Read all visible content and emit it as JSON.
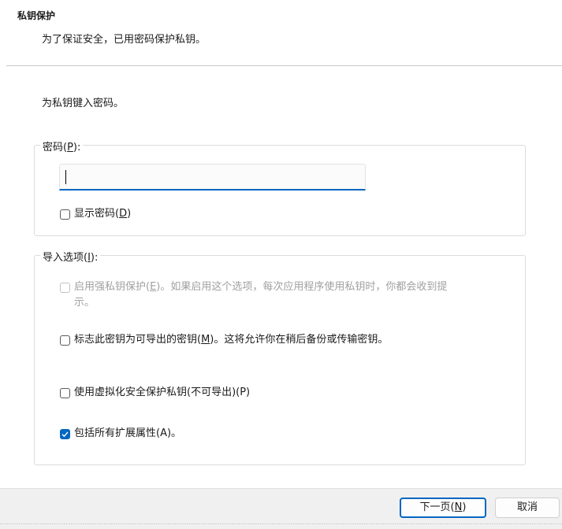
{
  "header": {
    "title": "私钥保护",
    "subtitle": "为了保证安全，已用密码保护私钥。"
  },
  "prompt": "为私钥键入密码。",
  "password_group": {
    "legend_prefix": "密码(",
    "legend_key": "P",
    "legend_suffix": "):",
    "input_value": "",
    "show_password": {
      "prefix": "显示密码(",
      "key": "D",
      "suffix": ")",
      "checked": false
    }
  },
  "import_group": {
    "legend_prefix": "导入选项(",
    "legend_key": "I",
    "legend_suffix": "):",
    "options": [
      {
        "prefix": "启用强私钥保护(",
        "key": "E",
        "suffix": ")。如果启用这个选项，每次应用程序使用私钥时，你都会收到提",
        "line2": "示。",
        "checked": false,
        "disabled": true
      },
      {
        "prefix": "标志此密钥为可导出的密钥(",
        "key": "M",
        "suffix": ")。这将允许你在稍后备份或传输密钥。",
        "checked": false,
        "disabled": false
      },
      {
        "prefix": "使用虚拟化安全保护私钥(不可导出)(P)",
        "key": "",
        "suffix": "",
        "checked": false,
        "disabled": false
      },
      {
        "prefix": "包括所有扩展属性(A)。",
        "key": "",
        "suffix": "",
        "checked": true,
        "disabled": false
      }
    ]
  },
  "footer": {
    "next_prefix": "下一页(",
    "next_key": "N",
    "next_suffix": ")",
    "cancel_label": "取消"
  },
  "colors": {
    "accent": "#0067c0"
  }
}
